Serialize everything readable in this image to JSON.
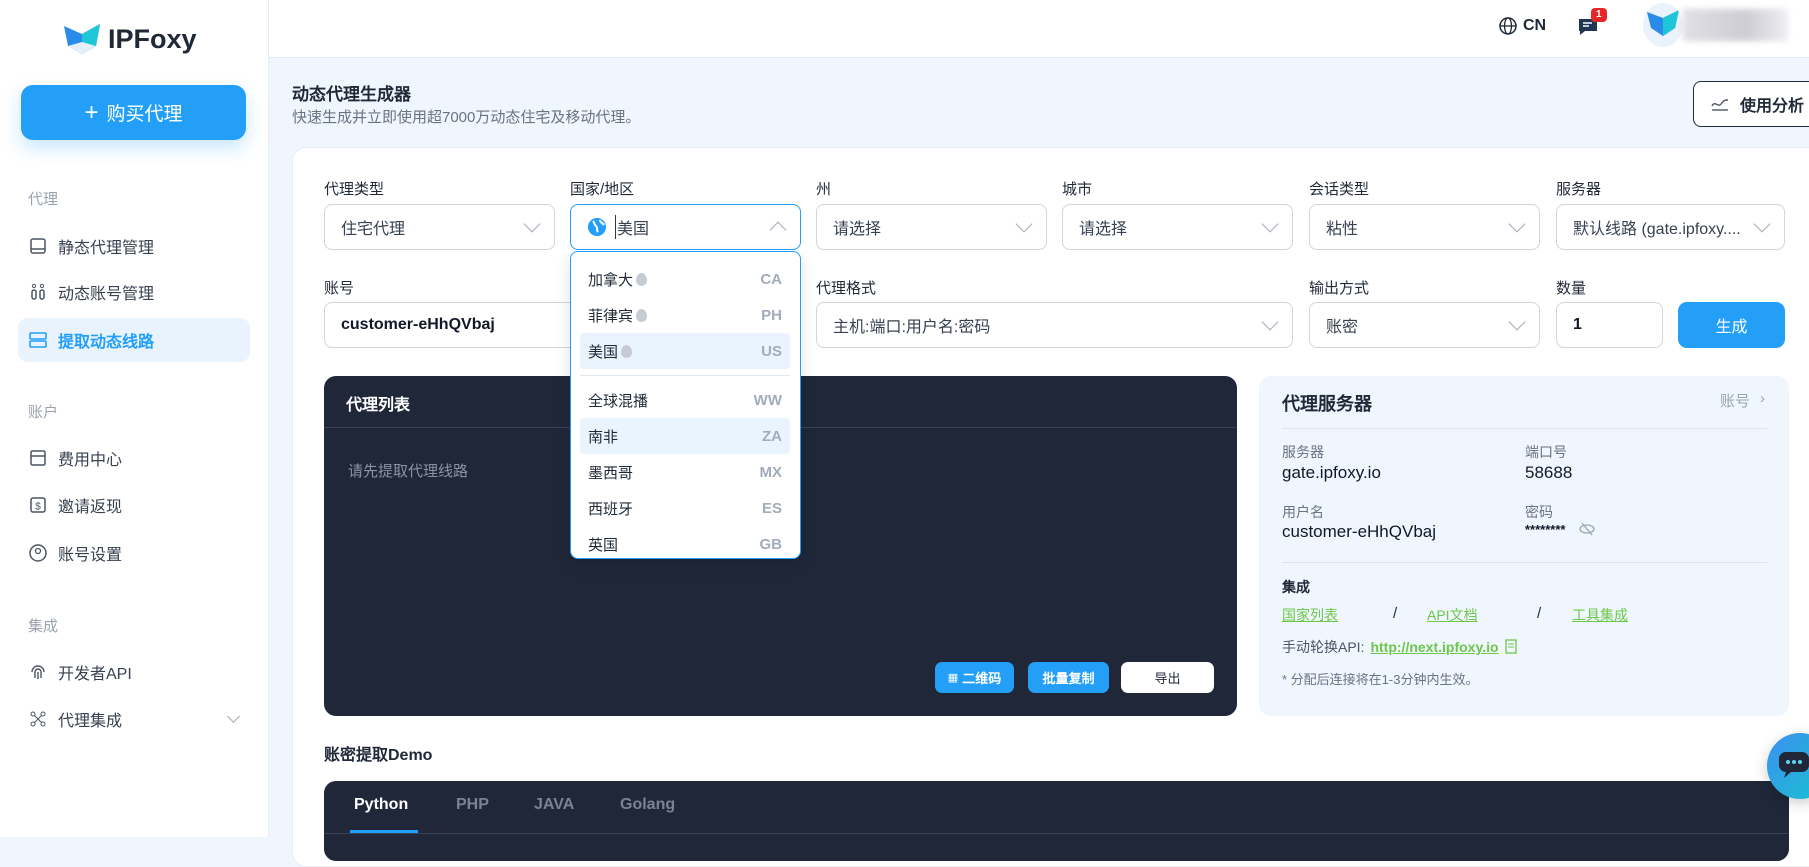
{
  "brand": {
    "name": "IPFoxy"
  },
  "sidebar": {
    "buy_label": "购买代理",
    "sections": [
      {
        "title": "代理"
      },
      {
        "title": "账户"
      },
      {
        "title": "集成"
      }
    ],
    "items": [
      {
        "label": "静态代理管理"
      },
      {
        "label": "动态账号管理"
      },
      {
        "label": "提取动态线路"
      },
      {
        "label": "费用中心"
      },
      {
        "label": "邀请返现"
      },
      {
        "label": "账号设置"
      },
      {
        "label": "开发者API"
      },
      {
        "label": "代理集成"
      }
    ]
  },
  "topbar": {
    "language": "CN",
    "notification_count": "1"
  },
  "page": {
    "title": "动态代理生成器",
    "subtitle": "快速生成并立即使用超7000万动态住宅及移动代理。",
    "analysis_label": "使用分析"
  },
  "form": {
    "proxy_type": {
      "label": "代理类型",
      "value": "住宅代理"
    },
    "country": {
      "label": "国家/地区",
      "value": "美国"
    },
    "state": {
      "label": "州",
      "placeholder": "请选择"
    },
    "city": {
      "label": "城市",
      "placeholder": "请选择"
    },
    "session": {
      "label": "会话类型",
      "value": "粘性"
    },
    "server": {
      "label": "服务器",
      "value": "默认线路 (gate.ipfoxy...."
    },
    "account": {
      "label": "账号",
      "value": "customer-eHhQVbaj"
    },
    "format": {
      "label": "代理格式",
      "value": "主机:端口:用户名:密码"
    },
    "output": {
      "label": "输出方式",
      "value": "账密"
    },
    "quantity": {
      "label": "数量",
      "value": "1"
    },
    "generate_label": "生成"
  },
  "country_dropdown": {
    "options": [
      {
        "name": "加拿大",
        "code": "CA",
        "hot": true
      },
      {
        "name": "菲律宾",
        "code": "PH",
        "hot": true
      },
      {
        "name": "美国",
        "code": "US",
        "hot": true
      },
      {
        "name": "全球混播",
        "code": "WW"
      },
      {
        "name": "南非",
        "code": "ZA"
      },
      {
        "name": "墨西哥",
        "code": "MX"
      },
      {
        "name": "西班牙",
        "code": "ES"
      },
      {
        "name": "英国",
        "code": "GB"
      }
    ]
  },
  "proxy_list": {
    "title": "代理列表",
    "empty": "请先提取代理线路",
    "qr_label": "二维码",
    "copy_label": "批量复制",
    "export_label": "导出"
  },
  "server_panel": {
    "title": "代理服务器",
    "account_link": "账号",
    "server_label": "服务器",
    "server": "gate.ipfoxy.io",
    "port_label": "端口号",
    "port": "58688",
    "user_label": "用户名",
    "user": "customer-eHhQVbaj",
    "pass_label": "密码",
    "pass": "********",
    "integration_title": "集成",
    "links": [
      "国家列表",
      "API文档",
      "工具集成"
    ],
    "sep": "/",
    "rotate_label": "手动轮换API:",
    "rotate_url": "http://next.ipfoxy.io",
    "note": "* 分配后连接将在1-3分钟内生效。"
  },
  "demo": {
    "title": "账密提取Demo",
    "tabs": [
      "Python",
      "PHP",
      "JAVA",
      "Golang"
    ]
  }
}
